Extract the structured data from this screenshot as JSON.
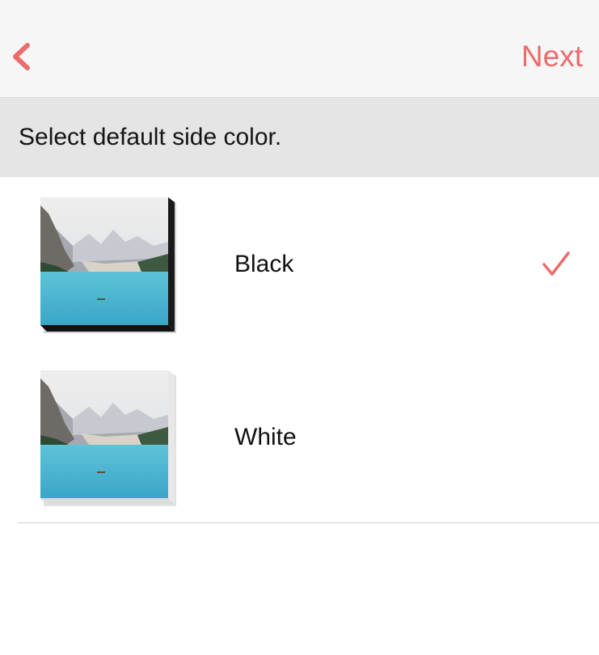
{
  "navbar": {
    "back_icon": "chevron-left-icon",
    "next_label": "Next",
    "accent_color": "#ea6c6c"
  },
  "section": {
    "header": "Select default side color."
  },
  "options": [
    {
      "label": "Black",
      "side_color": "#1a1a1a",
      "selected": true,
      "thumbnail": "lake-mountain-canvas-black-sides"
    },
    {
      "label": "White",
      "side_color": "#e8e8e8",
      "selected": false,
      "thumbnail": "lake-mountain-canvas-white-sides"
    }
  ],
  "checkmark_icon": "checkmark-icon"
}
